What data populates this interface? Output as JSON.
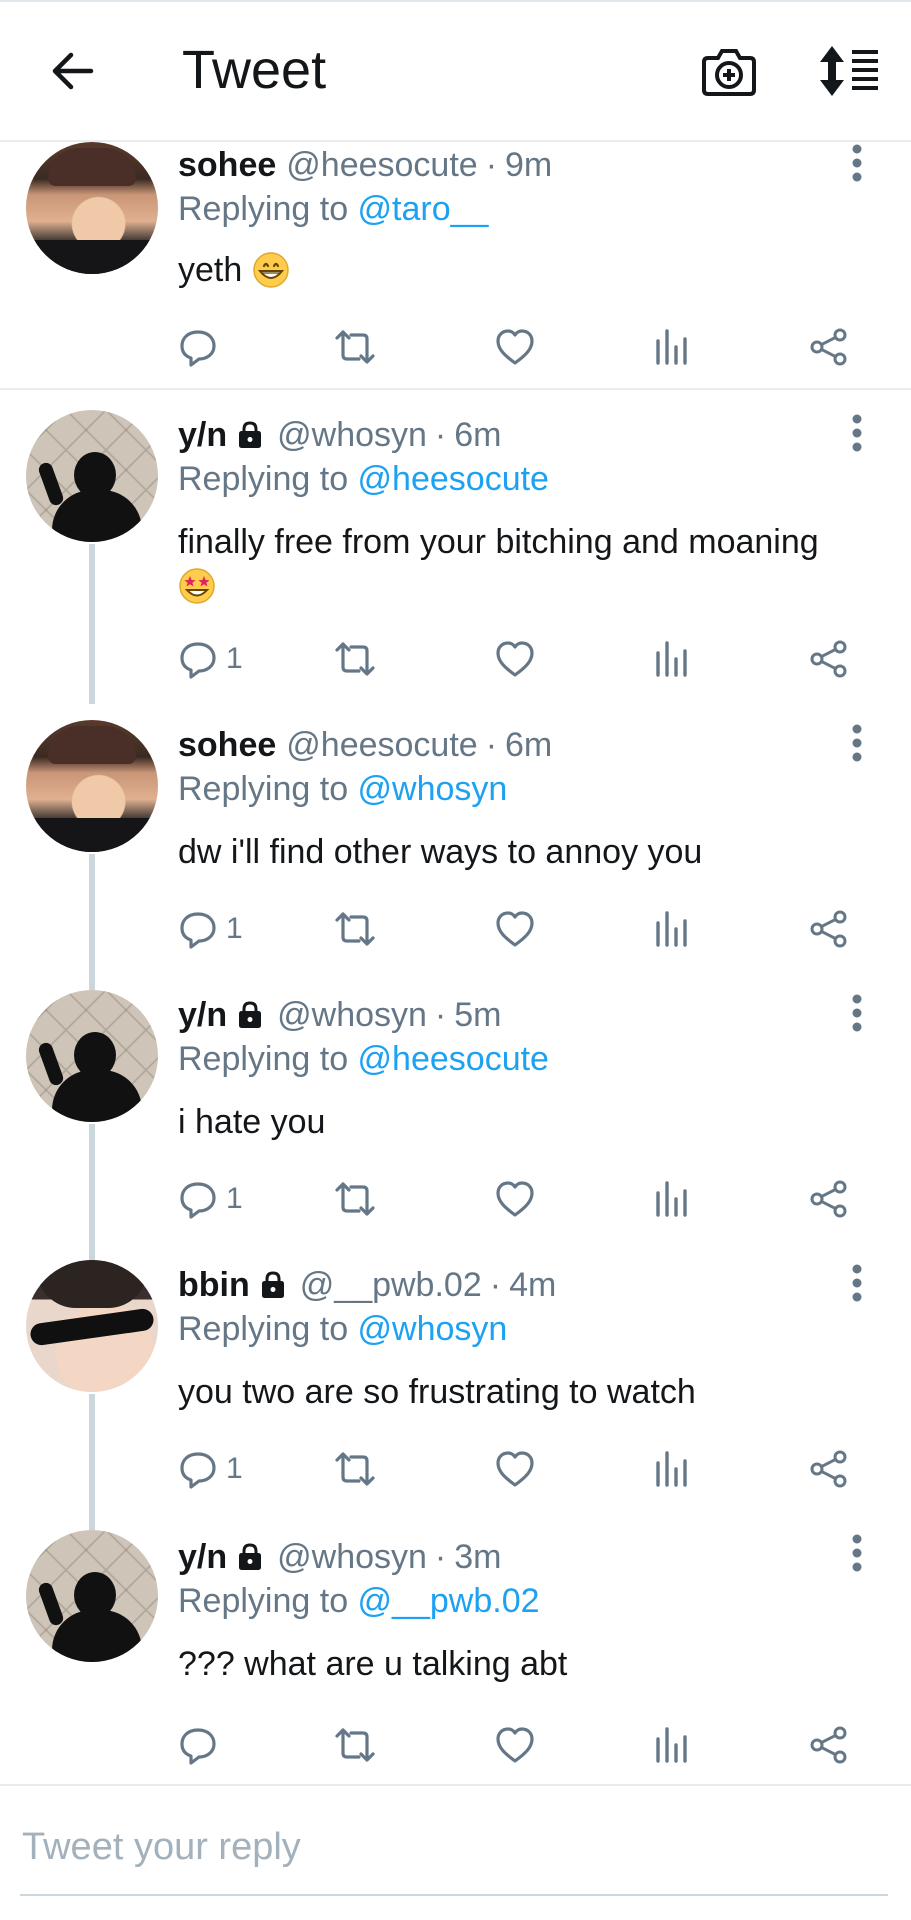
{
  "header": {
    "title": "Tweet",
    "back_icon": "arrow-left-icon",
    "camera_icon": "camera-plus-icon",
    "sort_icon": "sort-list-icon"
  },
  "colors": {
    "link": "#1da1f2",
    "secondary": "#657786",
    "divider": "#e6ecf0",
    "thread_line": "#ccd6dd"
  },
  "tweets": [
    {
      "name": "sohee",
      "locked": false,
      "handle": "@heesocute",
      "dot": "·",
      "time": "9m",
      "replying_prefix": "Replying to ",
      "replying_to": "@taro__",
      "text": "yeth",
      "emoji": "grinning-face",
      "reply_count": ""
    },
    {
      "name": "y/n",
      "locked": true,
      "handle": "@whosyn",
      "dot": "·",
      "time": "6m",
      "replying_prefix": "Replying to ",
      "replying_to": "@heesocute",
      "text": "finally free from your bitching and moaning",
      "emoji": "star-struck-face",
      "reply_count": "1"
    },
    {
      "name": "sohee",
      "locked": false,
      "handle": "@heesocute",
      "dot": "·",
      "time": "6m",
      "replying_prefix": "Replying to ",
      "replying_to": "@whosyn",
      "text": "dw i'll find other ways to annoy you",
      "reply_count": "1"
    },
    {
      "name": "y/n",
      "locked": true,
      "handle": "@whosyn",
      "dot": "·",
      "time": "5m",
      "replying_prefix": "Replying to ",
      "replying_to": "@heesocute",
      "text": "i hate you",
      "reply_count": "1"
    },
    {
      "name": "bbin",
      "locked": true,
      "handle": "@__pwb.02",
      "dot": "·",
      "time": "4m",
      "replying_prefix": "Replying to ",
      "replying_to": "@whosyn",
      "text": "you two are so frustrating to watch",
      "reply_count": "1"
    },
    {
      "name": "y/n",
      "locked": true,
      "handle": "@whosyn",
      "dot": "·",
      "time": "3m",
      "replying_prefix": "Replying to ",
      "replying_to": "@__pwb.02",
      "text": "??? what are u talking abt",
      "reply_count": ""
    }
  ],
  "reply_bar": {
    "placeholder": "Tweet your reply"
  }
}
